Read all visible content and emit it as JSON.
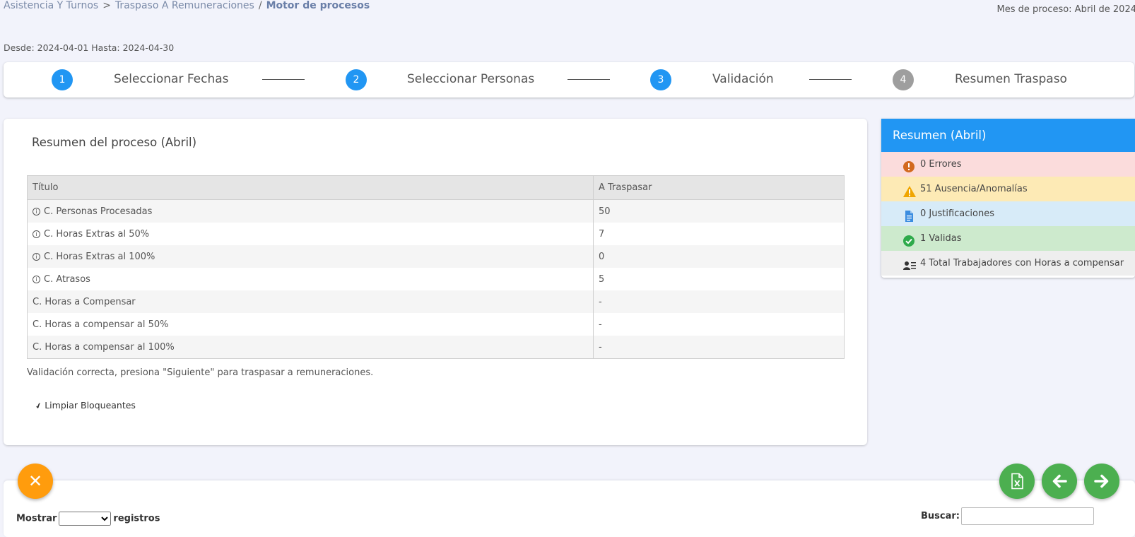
{
  "breadcrumb": {
    "items": [
      "Asistencia Y Turnos",
      "Traspaso A Remuneraciones"
    ],
    "separators": [
      ">",
      "/"
    ],
    "current": "Motor de procesos"
  },
  "mes_proceso": "Mes de proceso: Abril de 2024",
  "range": "Desde: 2024-04-01 Hasta: 2024-04-30",
  "stepper": {
    "steps": [
      {
        "number": "1",
        "label": "Seleccionar Fechas",
        "state": "active"
      },
      {
        "number": "2",
        "label": "Seleccionar Personas",
        "state": "active"
      },
      {
        "number": "3",
        "label": "Validación",
        "state": "active"
      },
      {
        "number": "4",
        "label": "Resumen Traspaso",
        "state": "pending"
      }
    ]
  },
  "main": {
    "title": "Resumen del proceso (Abril)",
    "table": {
      "headers": [
        "Título",
        "A Traspasar"
      ],
      "rows": [
        {
          "title": "C. Personas Procesadas",
          "value": "50",
          "info": true
        },
        {
          "title": "C. Horas Extras al 50%",
          "value": "7",
          "info": true
        },
        {
          "title": "C. Horas Extras al 100%",
          "value": "0",
          "info": true
        },
        {
          "title": "C. Atrasos",
          "value": "5",
          "info": true
        },
        {
          "title": "C. Horas a Compensar",
          "value": "-",
          "info": false
        },
        {
          "title": "C. Horas a compensar al 50%",
          "value": "-",
          "info": false
        },
        {
          "title": "C. Horas a compensar al 100%",
          "value": "-",
          "info": false
        }
      ]
    },
    "message": "Validación correcta, presiona \"Siguiente\" para traspasar a remuneraciones.",
    "limpiar_label": "Limpiar Bloqueantes"
  },
  "side": {
    "title": "Resumen (Abril)",
    "rows": {
      "errores": "0 Errores",
      "ausencias": "51 Ausencia/Anomalías",
      "justificaciones": "0 Justificaciones",
      "validas": "1 Validas",
      "total": "4 Total Trabajadores con Horas a compensar"
    }
  },
  "bottom": {
    "mostrar_label": "Mostrar",
    "registros_label": "registros",
    "buscar_label": "Buscar:"
  },
  "icons": {
    "cancel": "close-icon",
    "excel": "excel-file-icon",
    "back": "arrow-left-icon",
    "next": "arrow-right-icon"
  },
  "colors": {
    "primary": "#2196f3",
    "pending": "#9e9e9e",
    "cancel": "#ff9c0d",
    "green": "#4caf50",
    "error": "#d2691e",
    "warning": "#f0a500",
    "justification": "#3b8de0",
    "valid": "#2eaa4a"
  }
}
